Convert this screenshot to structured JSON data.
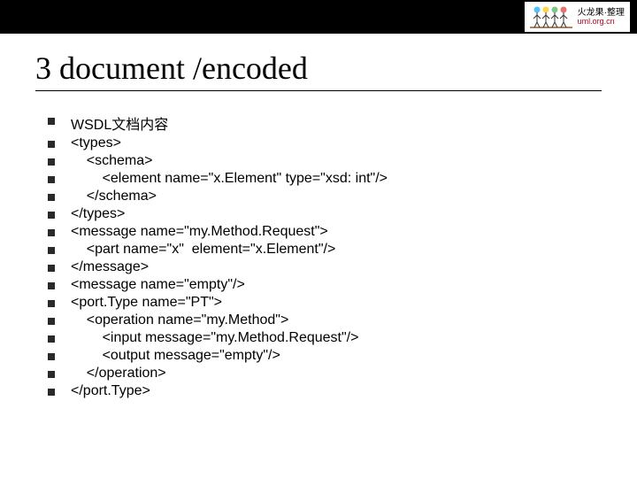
{
  "logo": {
    "text_top": "火龙果·整理",
    "text_bottom": "uml.org.cn"
  },
  "title": "3 document /encoded",
  "bullets": [
    "WSDL文档内容",
    "<types>",
    "    <schema>",
    "        <element name=\"x.Element\" type=\"xsd: int\"/>",
    "    </schema>",
    "</types>",
    "<message name=\"my.Method.Request\">",
    "    <part name=\"x\"  element=\"x.Element\"/>",
    "</message>",
    "<message name=\"empty\"/>",
    "<port.Type name=\"PT\">",
    "    <operation name=\"my.Method\">",
    "        <input message=\"my.Method.Request\"/>",
    "        <output message=\"empty\"/>",
    "    </operation>",
    "</port.Type>"
  ]
}
